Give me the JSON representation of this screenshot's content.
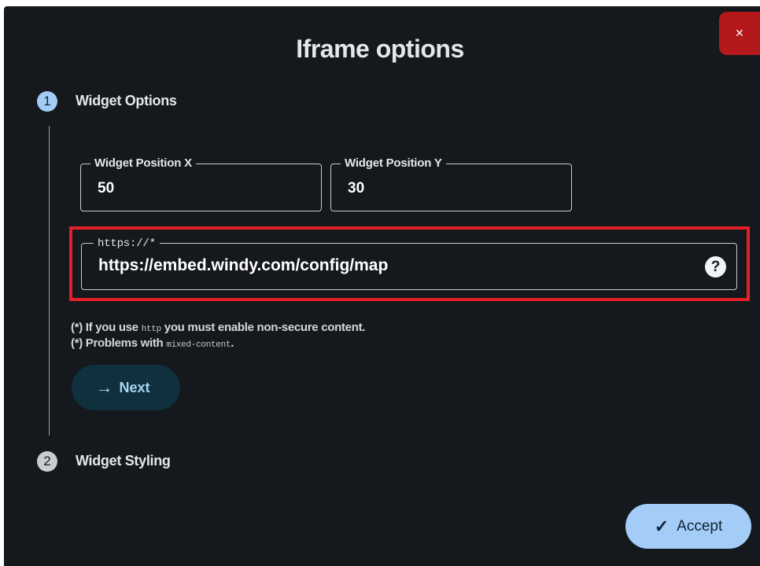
{
  "dialog": {
    "title": "Iframe options",
    "close_label": "×",
    "accept_label": "Accept"
  },
  "steps": [
    {
      "number": "1",
      "label": "Widget Options",
      "status": "active"
    },
    {
      "number": "2",
      "label": "Widget Styling",
      "status": "pending"
    }
  ],
  "fields": {
    "position_x": {
      "label": "Widget Position X",
      "value": "50"
    },
    "position_y": {
      "label": "Widget Position Y",
      "value": "30"
    },
    "url": {
      "label": "https://*",
      "value": "https://embed.windy.com/config/map",
      "help_icon": "?"
    }
  },
  "notes": [
    {
      "prefix": "(*) If you use ",
      "code": "http",
      "suffix": " you must enable non-secure content."
    },
    {
      "prefix": "(*) Problems with ",
      "code": "mixed-content",
      "suffix": "."
    }
  ],
  "next_label": "Next",
  "icons": {
    "next": "arrow-right-icon",
    "accept": "check-icon",
    "close": "close-icon",
    "help": "help-icon"
  },
  "colors": {
    "background": "#15181c",
    "accent": "#a3ccf6",
    "close": "#b3191a",
    "highlight": "#e32028"
  }
}
